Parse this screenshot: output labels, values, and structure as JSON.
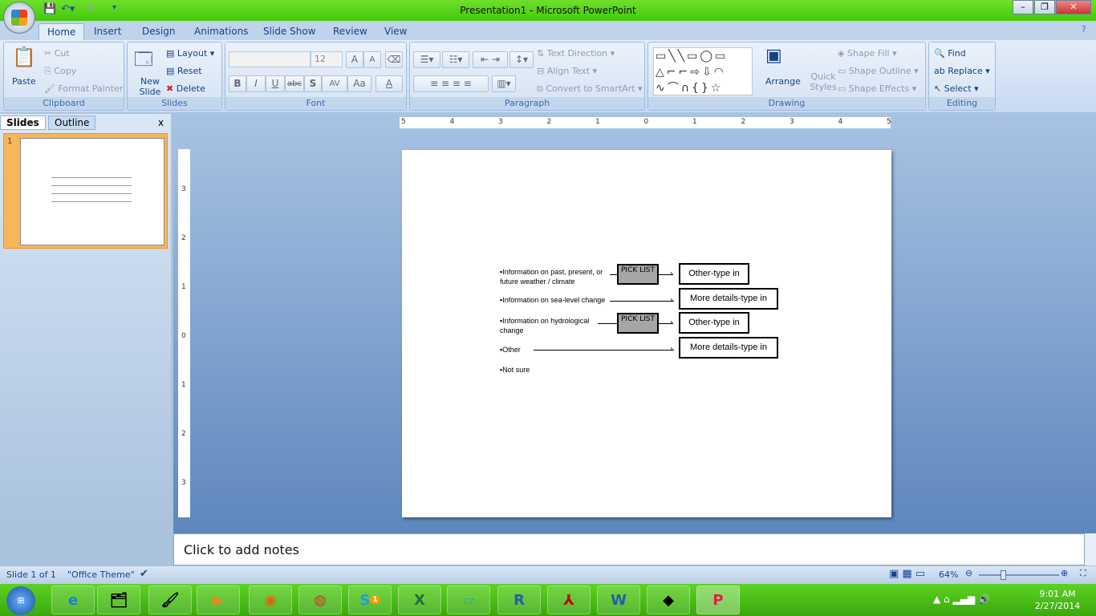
{
  "window": {
    "title": "Presentation1 - Microsoft PowerPoint",
    "min": "–",
    "max": "❐",
    "close": "✕"
  },
  "tabs": [
    "Home",
    "Insert",
    "Design",
    "Animations",
    "Slide Show",
    "Review",
    "View"
  ],
  "ribbon": {
    "clipboard": {
      "label": "Clipboard",
      "paste": "Paste",
      "cut": "Cut",
      "copy": "Copy",
      "format_painter": "Format Painter"
    },
    "slides": {
      "label": "Slides",
      "new_slide": "New Slide",
      "layout": "Layout",
      "reset": "Reset",
      "delete": "Delete"
    },
    "font": {
      "label": "Font",
      "font_name": "",
      "font_size": "12",
      "bold": "B",
      "italic": "I",
      "underline": "U",
      "strike": "abc",
      "shadow": "S",
      "spacing": "AV",
      "case": "Aa",
      "color": "A",
      "grow": "A",
      "shrink": "A"
    },
    "paragraph": {
      "label": "Paragraph",
      "text_direction": "Text Direction",
      "align_text": "Align Text",
      "convert": "Convert to SmartArt"
    },
    "drawing": {
      "label": "Drawing",
      "arrange": "Arrange",
      "quick_styles": "Quick Styles",
      "shape_fill": "Shape Fill",
      "shape_outline": "Shape Outline",
      "shape_effects": "Shape Effects"
    },
    "editing": {
      "label": "Editing",
      "find": "Find",
      "replace": "Replace",
      "select": "Select"
    }
  },
  "pane": {
    "tabs": [
      "Slides",
      "Outline"
    ],
    "close": "x",
    "slide_number": "1"
  },
  "ruler": {
    "h": [
      "5",
      "4",
      "3",
      "2",
      "1",
      "0",
      "1",
      "2",
      "3",
      "4",
      "5"
    ],
    "v": [
      "3",
      "2",
      "1",
      "0",
      "1",
      "2",
      "3"
    ]
  },
  "slide": {
    "bullets": [
      "Information on past, present, or future weather / climate",
      "Information on sea-level change",
      "Information on hydrological change",
      "Other",
      "Not sure"
    ],
    "pick_list": "PICK LIST",
    "boxes": [
      "Other-type in",
      "More details-type in",
      "Other-type in",
      "More details-type in"
    ]
  },
  "notes": {
    "placeholder": "Click to add notes"
  },
  "status": {
    "slide": "Slide 1 of 1",
    "theme": "\"Office Theme\"",
    "zoom": "64%",
    "zoom_level": 64
  },
  "taskbar": {
    "time": "9:01 AM",
    "date": "2/27/2014",
    "skype_badge": "1"
  }
}
